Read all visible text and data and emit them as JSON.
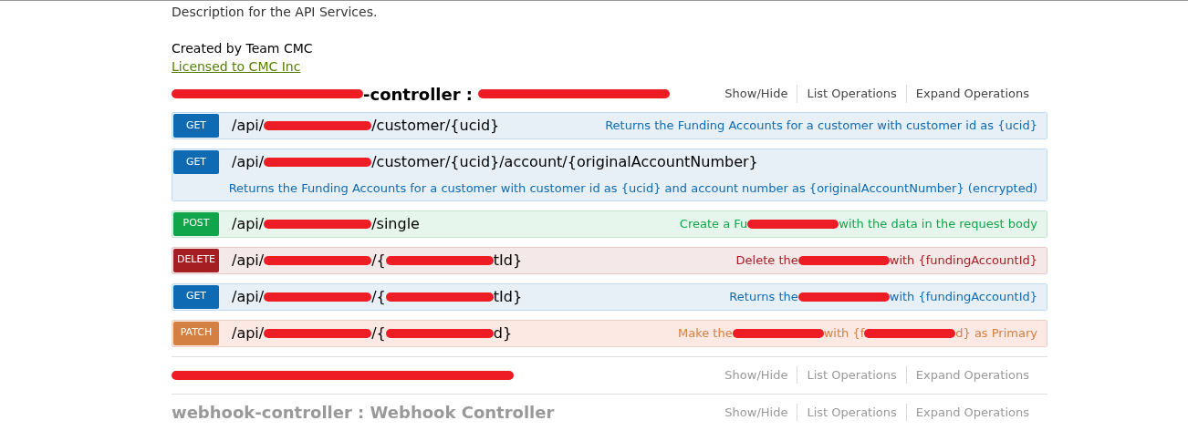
{
  "info": {
    "description": "Description for the API Services.",
    "created_by": "Created by Team CMC",
    "license": "Licensed to CMC Inc"
  },
  "sections": [
    {
      "expanded": true,
      "heading": [
        {
          "kind": "redacted"
        },
        {
          "kind": "text",
          "text": "-controller"
        },
        {
          "kind": "text",
          "text": " : "
        },
        {
          "kind": "redacted"
        }
      ],
      "links": [
        "Show/Hide",
        "List Operations",
        "Expand Operations"
      ],
      "operations": [
        {
          "method": "GET",
          "kind": "inline",
          "path": [
            {
              "kind": "text",
              "text": "/api/"
            },
            {
              "kind": "redacted"
            },
            {
              "kind": "text",
              "text": "/customer/{ucid}"
            }
          ],
          "summary": [
            {
              "kind": "text",
              "text": "Returns the Funding Accounts for a customer with customer id as {ucid}"
            }
          ]
        },
        {
          "method": "GET",
          "kind": "stacked",
          "path": [
            {
              "kind": "text",
              "text": "/api/"
            },
            {
              "kind": "redacted"
            },
            {
              "kind": "text",
              "text": "/customer/{ucid}/account/{originalAccountNumber}"
            }
          ],
          "summary": [
            {
              "kind": "text",
              "text": "Returns the Funding Accounts for a customer with customer id as {ucid} and account number as {originalAccountNumber} (encrypted)"
            }
          ]
        },
        {
          "method": "POST",
          "kind": "inline",
          "path": [
            {
              "kind": "text",
              "text": "/api/"
            },
            {
              "kind": "redacted"
            },
            {
              "kind": "text",
              "text": "/single"
            }
          ],
          "summary": [
            {
              "kind": "text",
              "text": "Create a Fu"
            },
            {
              "kind": "redacted"
            },
            {
              "kind": "text",
              "text": "with the data in the request body"
            }
          ]
        },
        {
          "method": "DELETE",
          "kind": "inline",
          "path": [
            {
              "kind": "text",
              "text": "/api/"
            },
            {
              "kind": "redacted"
            },
            {
              "kind": "text",
              "text": "/{"
            },
            {
              "kind": "redacted"
            },
            {
              "kind": "text",
              "text": "tId}"
            }
          ],
          "summary": [
            {
              "kind": "text",
              "text": "Delete the"
            },
            {
              "kind": "redacted"
            },
            {
              "kind": "text",
              "text": "with {fundingAccountId}"
            }
          ]
        },
        {
          "method": "GET",
          "kind": "inline",
          "path": [
            {
              "kind": "text",
              "text": "/api/"
            },
            {
              "kind": "redacted"
            },
            {
              "kind": "text",
              "text": "/{"
            },
            {
              "kind": "redacted"
            },
            {
              "kind": "text",
              "text": "tId}"
            }
          ],
          "summary": [
            {
              "kind": "text",
              "text": "Returns the"
            },
            {
              "kind": "redacted"
            },
            {
              "kind": "text",
              "text": "with {fundingAccountId}"
            }
          ]
        },
        {
          "method": "PATCH",
          "kind": "inline",
          "path": [
            {
              "kind": "text",
              "text": "/api/"
            },
            {
              "kind": "redacted"
            },
            {
              "kind": "text",
              "text": "/{"
            },
            {
              "kind": "redacted"
            },
            {
              "kind": "text",
              "text": "d}"
            }
          ],
          "summary": [
            {
              "kind": "text",
              "text": "Make the"
            },
            {
              "kind": "redacted"
            },
            {
              "kind": "text",
              "text": "with {f"
            },
            {
              "kind": "redacted"
            },
            {
              "kind": "text",
              "text": "d} as Primary"
            }
          ]
        }
      ]
    },
    {
      "expanded": false,
      "heading": [
        {
          "kind": "redacted"
        }
      ],
      "links": [
        "Show/Hide",
        "List Operations",
        "Expand Operations"
      ]
    },
    {
      "expanded": false,
      "heading": [
        {
          "kind": "text",
          "text": "webhook-controller"
        },
        {
          "kind": "text",
          "text": " : Webhook Controller"
        }
      ],
      "links": [
        "Show/Hide",
        "List Operations",
        "Expand Operations"
      ]
    }
  ]
}
